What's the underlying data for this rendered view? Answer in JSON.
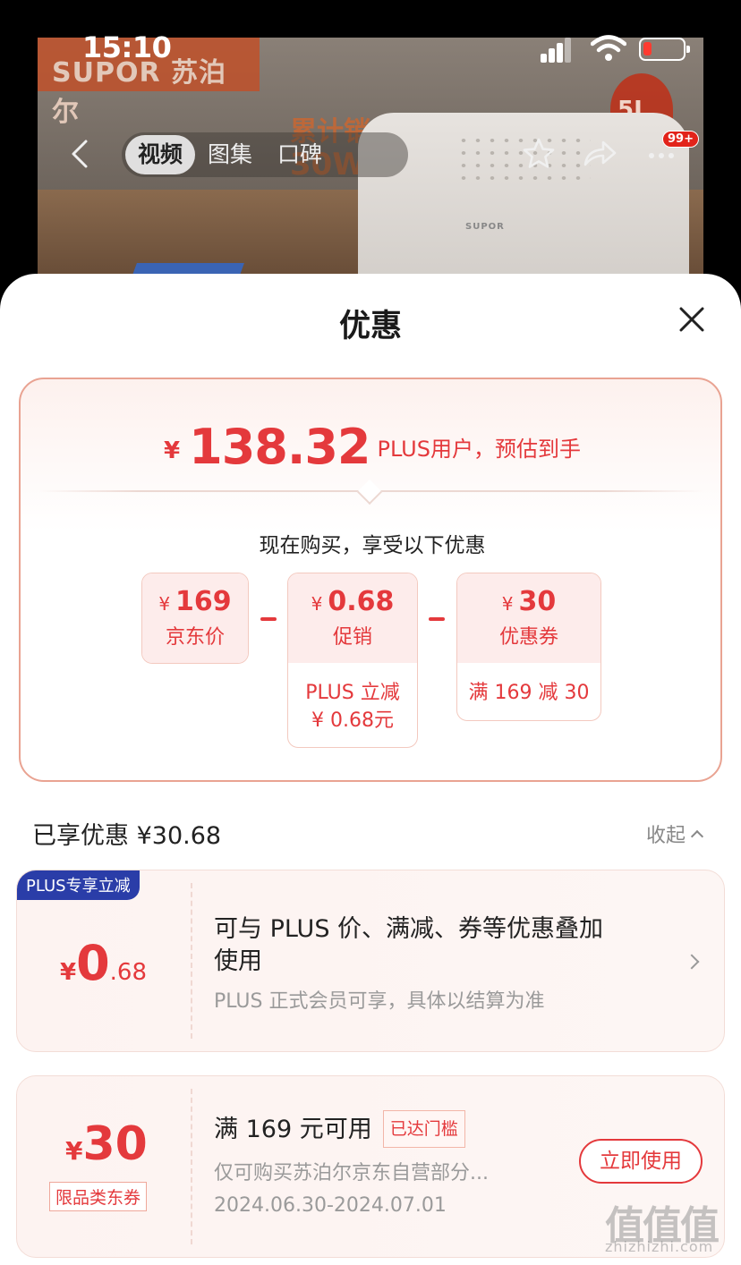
{
  "status_bar": {
    "time": "15:10"
  },
  "hero": {
    "brand": "SUPOR 苏泊尔",
    "promo_line1": "累计销售",
    "promo_line2": "30W+",
    "capacity": "5L",
    "appliance_logo": "SUPOR"
  },
  "nav": {
    "tabs": [
      {
        "label": "视频"
      },
      {
        "label": "图集"
      },
      {
        "label": "口碑"
      }
    ],
    "message_badge": "99+",
    "icons": [
      "back-chevron-icon",
      "star-icon",
      "share-icon",
      "more-icon"
    ]
  },
  "sheet": {
    "title": "优惠",
    "estimate": {
      "currency": "¥",
      "amount": "138.32",
      "suffix": "PLUS用户，预估到手"
    },
    "enjoy_text": "现在购买，享受以下优惠",
    "breakdown": [
      {
        "value": "169",
        "currency": "¥",
        "label": "京东价",
        "detail": []
      },
      {
        "value": "0.68",
        "currency": "¥",
        "label": "促销",
        "detail": [
          "PLUS 立减",
          "¥ 0.68元"
        ]
      },
      {
        "value": "30",
        "currency": "¥",
        "label": "优惠券",
        "detail": [
          "满 169 减 30"
        ]
      }
    ],
    "saved": {
      "label": "已享优惠 ¥30.68",
      "toggle": "收起"
    },
    "promo_card": {
      "tag": "PLUS专享立减",
      "currency": "¥",
      "amount_int": "0",
      "amount_dec": ".68",
      "title_line1": "可与 PLUS 价、满减、券等优惠叠加",
      "title_line2": "使用",
      "desc": "PLUS 正式会员可享，具体以结算为准"
    },
    "coupon_card": {
      "currency": "¥",
      "amount": "30",
      "kind": "限品类东券",
      "title": "满 169 元可用",
      "status": "已达门槛",
      "desc": "仅可购买苏泊尔京东自营部分...",
      "validity": "2024.06.30-2024.07.01",
      "button": "立即使用"
    },
    "watermark": "值值值",
    "watermark_sub": "zhizhizhi.com"
  },
  "colors": {
    "accent": "#e4393c",
    "plus_tag": "#2a3da8",
    "card_border": "#e9a392"
  }
}
